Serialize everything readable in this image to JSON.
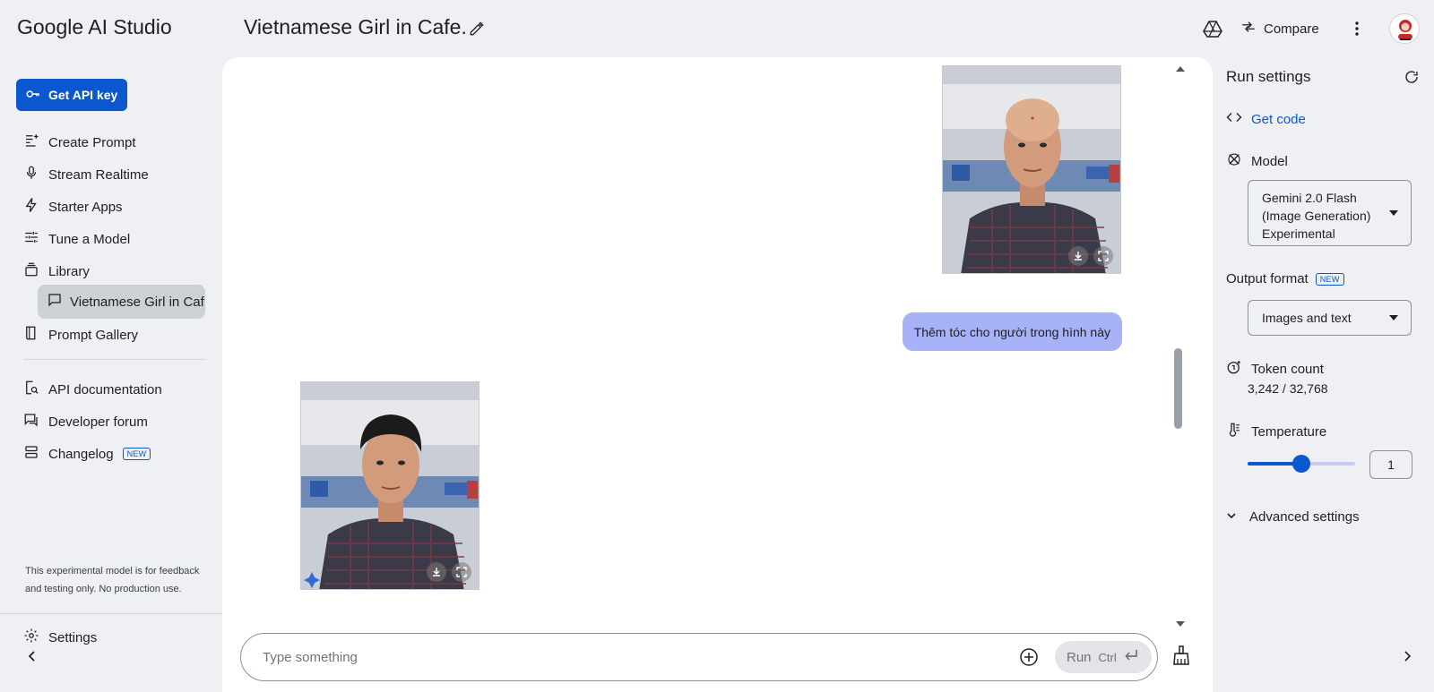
{
  "header": {
    "brand": "Google AI Studio",
    "title": "Vietnamese Girl in Cafe.",
    "compare_label": "Compare",
    "icons": [
      "edit-icon",
      "drive-icon",
      "compare-icon",
      "more-vert-icon",
      "avatar"
    ]
  },
  "sidebar": {
    "api_key_label": "Get API key",
    "items": [
      {
        "label": "Create Prompt",
        "icon": "create-prompt-icon"
      },
      {
        "label": "Stream Realtime",
        "icon": "mic-icon"
      },
      {
        "label": "Starter Apps",
        "icon": "bolt-icon"
      },
      {
        "label": "Tune a Model",
        "icon": "tune-icon"
      },
      {
        "label": "Library",
        "icon": "library-icon"
      }
    ],
    "active_item": {
      "label": "Vietnamese Girl in Caf...",
      "icon": "chat-icon"
    },
    "gallery": {
      "label": "Prompt Gallery",
      "icon": "book-icon"
    },
    "resources": [
      {
        "label": "API documentation",
        "icon": "doc-search-icon"
      },
      {
        "label": "Developer forum",
        "icon": "forum-icon"
      },
      {
        "label": "Changelog",
        "icon": "changelog-icon",
        "badge": "NEW"
      }
    ],
    "note": "This experimental model is for feedback and testing only. No production use.",
    "settings_label": "Settings"
  },
  "chat": {
    "user_message": "Thêm tóc cho người trong hình này",
    "input_placeholder": "Type something",
    "run_label": "Run",
    "run_shortcut": "Ctrl"
  },
  "run_settings": {
    "title": "Run settings",
    "get_code_label": "Get code",
    "model_label": "Model",
    "model_value_lines": [
      "Gemini 2.0 Flash",
      "(Image Generation)",
      "Experimental"
    ],
    "output_format_label": "Output format",
    "output_format_badge": "NEW",
    "output_format_value": "Images and text",
    "token_count_label": "Token count",
    "token_count_value": "3,242 / 32,768",
    "temperature_label": "Temperature",
    "temperature_value": "1",
    "temperature_fraction": 0.5,
    "advanced_label": "Advanced settings"
  },
  "colors": {
    "accent": "#0b57d0",
    "bubble": "#a7b3f6",
    "active_nav": "#cdd0d5",
    "background": "#eef0f3"
  }
}
